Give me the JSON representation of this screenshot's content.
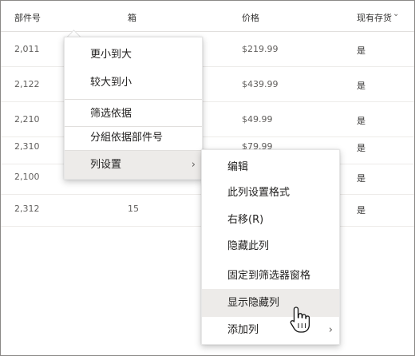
{
  "columns": [
    "部件号",
    "箱",
    "价格",
    "现有存货"
  ],
  "rows": [
    {
      "part": "2,011",
      "bin": "",
      "price": "$219.99",
      "stock": "是"
    },
    {
      "part": "2,122",
      "bin": "",
      "price": "$439.99",
      "stock": "是"
    },
    {
      "part": "2,210",
      "bin": "",
      "price": "$49.99",
      "stock": "是"
    },
    {
      "part": "2,310",
      "bin": "",
      "price": "$79.99",
      "stock": "是"
    },
    {
      "part": "2,100",
      "bin": "",
      "price": "",
      "stock": "是"
    },
    {
      "part": "2,312",
      "bin": "15",
      "price": "",
      "stock": "是"
    }
  ],
  "main_menu": {
    "sort_asc": "更小到大",
    "sort_desc": "较大到小",
    "filter_by": "筛选依据",
    "group_by": "分組依据部件号",
    "column_settings": "列设置"
  },
  "sub_menu": {
    "edit": "编辑",
    "format_column": "此列设置格式",
    "move_right": "右移(R)",
    "hide_column": "隐藏此列",
    "pin_filter": "固定到筛选器窗格",
    "show_hidden": "显示隐藏列",
    "add_column": "添加列"
  },
  "icons": {
    "chevron_down": "chevron-down-icon",
    "chevron_right": "chevron-right-icon",
    "cursor": "hand-pointer-icon"
  }
}
